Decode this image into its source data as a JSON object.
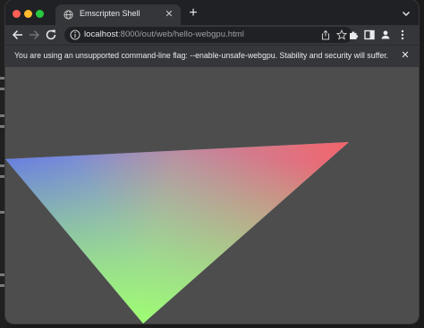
{
  "window": {
    "tab_title": "Emscripten Shell",
    "tab_icon": "globe-icon"
  },
  "toolbar": {
    "url_host": "localhost",
    "url_path": ":8000/out/web/hello-webgpu.html",
    "icons": [
      "back-icon",
      "forward-icon",
      "reload-icon",
      "info-icon",
      "share-icon",
      "star-icon",
      "extensions-icon",
      "side-panel-icon",
      "profile-icon",
      "menu-icon"
    ]
  },
  "infobar": {
    "message": "You are using an unsupported command-line flag: --enable-unsafe-webgpu. Stability and security will suffer."
  },
  "canvas": {
    "background": "#4d4d4d",
    "triangle_colors": {
      "left": "#5a5cff",
      "top-right": "#f4646a",
      "bottom": "#9efc72"
    }
  }
}
